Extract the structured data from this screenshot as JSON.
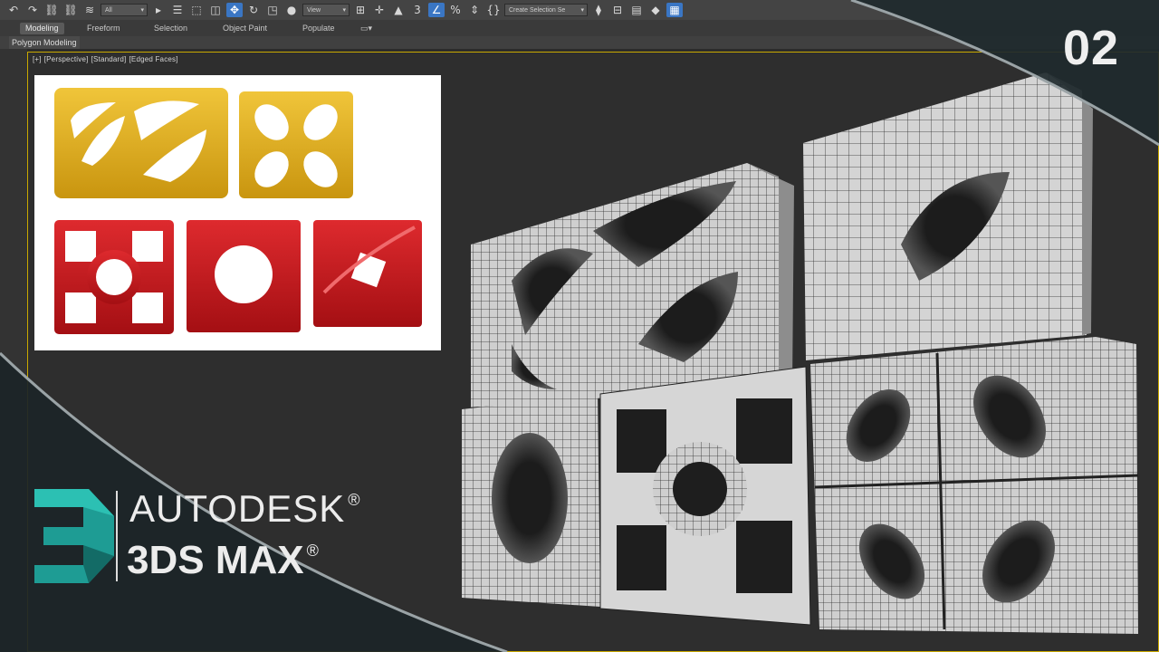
{
  "toolbar": {
    "selection_filter": "All",
    "view_dropdown": "View",
    "selection_set": "Create Selection Se",
    "icons": [
      "undo-icon",
      "redo-icon",
      "link-icon",
      "unlink-icon",
      "bind-spacewarp-icon",
      "select-icon",
      "select-by-name-icon",
      "rect-select-icon",
      "window-crossing-icon",
      "move-icon",
      "rotate-icon",
      "scale-icon",
      "place-icon",
      "snap-3-icon",
      "angle-snap-icon",
      "percent-snap-icon",
      "spinner-snap-icon",
      "edit-named-sets-icon",
      "mirror-icon",
      "align-icon",
      "layer-icon",
      "scene-explorer-icon",
      "ribbon-icon"
    ]
  },
  "ribbon": {
    "tabs": [
      "Modeling",
      "Freeform",
      "Selection",
      "Object Paint",
      "Populate"
    ],
    "active_tab": "Modeling",
    "panel_label": "Polygon Modeling"
  },
  "viewport": {
    "label_parts": [
      "[+]",
      "[Perspective]",
      "[Standard]",
      "[Edged Faces]"
    ]
  },
  "overlay": {
    "episode_number": "02",
    "brand_line1": "AUTODESK",
    "brand_line2": "3DS MAX",
    "reg_mark": "®"
  },
  "colors": {
    "viewport_border": "#c8a800",
    "yellow_block": "#e3b21c",
    "red_block": "#c8161c",
    "logo_teal": "#1e9c94",
    "active_button": "#3a76c4"
  }
}
